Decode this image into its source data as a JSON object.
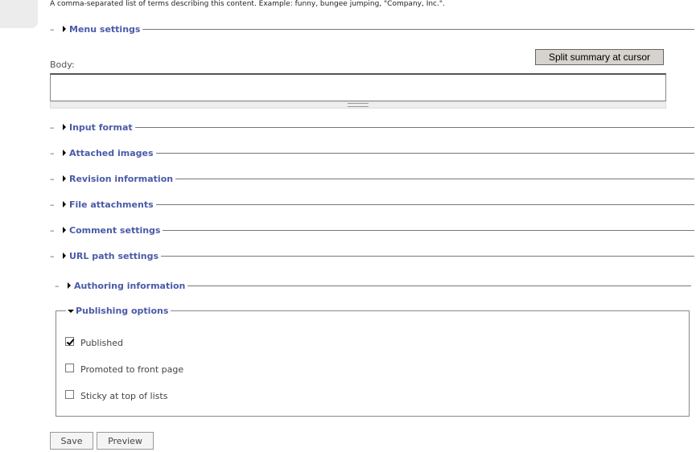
{
  "tags": {
    "description": "A comma-separated list of terms describing this content. Example: funny, bungee jumping, \"Company, Inc.\"."
  },
  "menu_settings": {
    "label": "Menu settings"
  },
  "body": {
    "label": "Body:",
    "split_button": "Split summary at cursor",
    "value": ""
  },
  "fieldsets": [
    {
      "label": "Input format"
    },
    {
      "label": "Attached images"
    },
    {
      "label": "Revision information"
    },
    {
      "label": "File attachments"
    },
    {
      "label": "Comment settings"
    },
    {
      "label": "URL path settings"
    },
    {
      "label": "Authoring information"
    }
  ],
  "publishing": {
    "label": "Publishing options",
    "options": [
      {
        "label": "Published",
        "checked": true
      },
      {
        "label": "Promoted to front page",
        "checked": false
      },
      {
        "label": "Sticky at top of lists",
        "checked": false
      }
    ]
  },
  "actions": {
    "save": "Save",
    "preview": "Preview"
  },
  "colors": {
    "legend": "#4a5aa8",
    "button_bg": "#d6d3ce"
  }
}
